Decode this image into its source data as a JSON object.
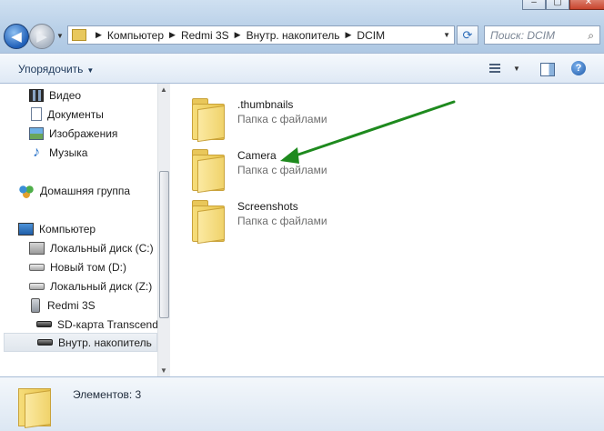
{
  "address_bar": {
    "breadcrumbs": [
      "Компьютер",
      "Redmi 3S",
      "Внутр. накопитель",
      "DCIM"
    ]
  },
  "search": {
    "placeholder": "Поиск: DCIM"
  },
  "toolbar": {
    "organize_label": "Упорядочить"
  },
  "sidebar": {
    "items": [
      {
        "label": "Видео",
        "icon": "video-icon"
      },
      {
        "label": "Документы",
        "icon": "documents-icon"
      },
      {
        "label": "Изображения",
        "icon": "pictures-icon"
      },
      {
        "label": "Музыка",
        "icon": "music-icon"
      },
      {
        "label": "Домашняя группа",
        "icon": "homegroup-icon"
      },
      {
        "label": "Компьютер",
        "icon": "computer-icon"
      },
      {
        "label": "Локальный диск (C:)",
        "icon": "system-drive-icon"
      },
      {
        "label": "Новый том (D:)",
        "icon": "drive-icon"
      },
      {
        "label": "Локальный диск (Z:)",
        "icon": "drive-icon"
      },
      {
        "label": "Redmi 3S",
        "icon": "phone-icon"
      },
      {
        "label": "SD-карта Transcend",
        "icon": "storage-icon"
      },
      {
        "label": "Внутр. накопитель",
        "icon": "storage-icon",
        "selected": true
      }
    ]
  },
  "main": {
    "folders": [
      {
        "name": ".thumbnails",
        "type": "Папка с файлами"
      },
      {
        "name": "Camera",
        "type": "Папка с файлами"
      },
      {
        "name": "Screenshots",
        "type": "Папка с файлами"
      }
    ],
    "annotation_arrow_color": "#1e8a1e"
  },
  "status": {
    "text": "Элементов: 3"
  }
}
